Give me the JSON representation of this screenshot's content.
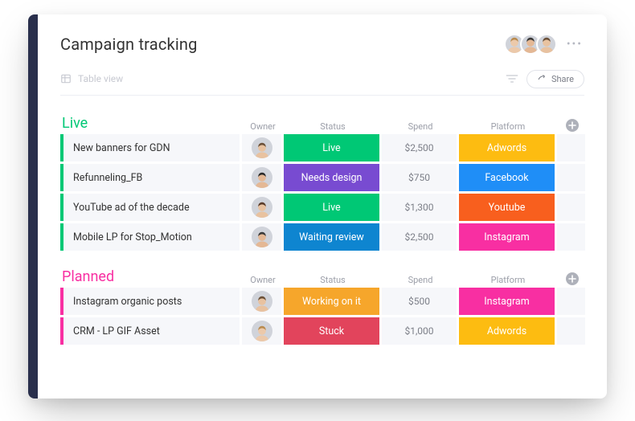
{
  "header": {
    "title": "Campaign tracking",
    "more_label": "•••"
  },
  "toolbar": {
    "view_label": "Table view",
    "share_label": "Share"
  },
  "columns": {
    "owner": "Owner",
    "status": "Status",
    "spend": "Spend",
    "platform": "Platform"
  },
  "groups": [
    {
      "title": "Live",
      "color": "#00c875",
      "rows": [
        {
          "name": "New banners for GDN",
          "owner_hair": "#6b5139",
          "owner_skin": "#e8c2a0",
          "status": "Live",
          "status_color": "#00c875",
          "spend": "$2,500",
          "platform": "Adwords",
          "platform_color": "#fdbc11"
        },
        {
          "name": "Refunneling_FB",
          "owner_hair": "#2b2b2b",
          "owner_skin": "#e4b895",
          "status": "Needs design",
          "status_color": "#784bd1",
          "spend": "$750",
          "platform": "Facebook",
          "platform_color": "#1f8ef7"
        },
        {
          "name": "YouTube ad of the decade",
          "owner_hair": "#5a3c2a",
          "owner_skin": "#e8c2a0",
          "status": "Live",
          "status_color": "#00c875",
          "spend": "$1,300",
          "platform": "Youtube",
          "platform_color": "#f85f1e"
        },
        {
          "name": "Mobile LP for Stop_Motion",
          "owner_hair": "#3a3a3a",
          "owner_skin": "#e4b895",
          "status": "Waiting review",
          "status_color": "#0e85d0",
          "spend": "$2,500",
          "platform": "Instagram",
          "platform_color": "#f82fa2"
        }
      ]
    },
    {
      "title": "Planned",
      "color": "#f82fa2",
      "rows": [
        {
          "name": "Instagram organic posts",
          "owner_hair": "#6b5139",
          "owner_skin": "#e8c2a0",
          "status": "Working on it",
          "status_color": "#f6a62b",
          "spend": "$500",
          "platform": "Instagram",
          "platform_color": "#f82fa2"
        },
        {
          "name": "CRM - LP GIF Asset",
          "owner_hair": "#b98b4f",
          "owner_skin": "#ecc9aa",
          "status": "Stuck",
          "status_color": "#e2445c",
          "spend": "$1,000",
          "platform": "Adwords",
          "platform_color": "#fdbc11"
        }
      ]
    }
  ],
  "member_avatars": [
    {
      "hair": "#b98b4f",
      "skin": "#ecc9aa"
    },
    {
      "hair": "#3a3a3a",
      "skin": "#e4b895"
    },
    {
      "hair": "#6b5139",
      "skin": "#e8c2a0"
    }
  ]
}
